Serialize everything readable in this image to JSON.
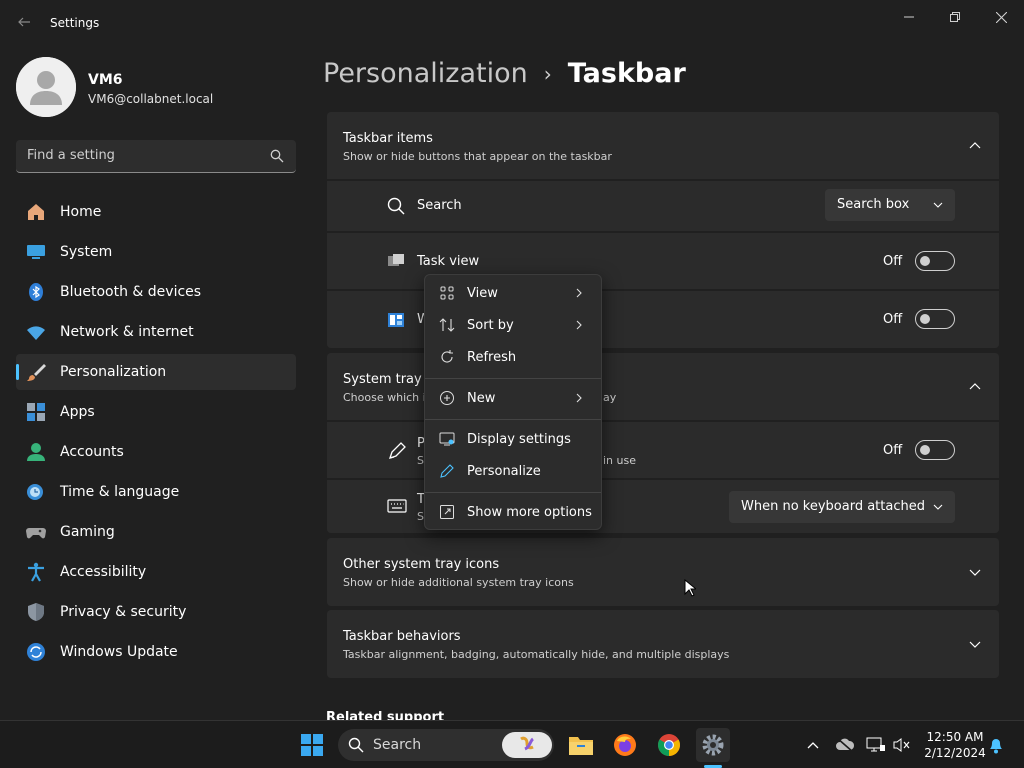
{
  "app": {
    "title": "Settings"
  },
  "user": {
    "name": "VM6",
    "email": "VM6@collabnet.local"
  },
  "search": {
    "placeholder": "Find a setting"
  },
  "nav": [
    {
      "label": "Home",
      "icon": "home-icon"
    },
    {
      "label": "System",
      "icon": "system-icon"
    },
    {
      "label": "Bluetooth & devices",
      "icon": "bluetooth-icon"
    },
    {
      "label": "Network & internet",
      "icon": "wifi-icon"
    },
    {
      "label": "Personalization",
      "icon": "brush-icon",
      "active": true
    },
    {
      "label": "Apps",
      "icon": "apps-icon"
    },
    {
      "label": "Accounts",
      "icon": "accounts-icon"
    },
    {
      "label": "Time & language",
      "icon": "clock-icon"
    },
    {
      "label": "Gaming",
      "icon": "gamepad-icon"
    },
    {
      "label": "Accessibility",
      "icon": "accessibility-icon"
    },
    {
      "label": "Privacy & security",
      "icon": "shield-icon"
    },
    {
      "label": "Windows Update",
      "icon": "update-icon"
    }
  ],
  "breadcrumb": {
    "parent": "Personalization",
    "separator": "›",
    "current": "Taskbar"
  },
  "taskbar_items": {
    "title": "Taskbar items",
    "subtitle": "Show or hide buttons that appear on the taskbar",
    "search": {
      "label": "Search",
      "value": "Search box"
    },
    "task_view": {
      "label": "Task view",
      "state": "Off"
    },
    "widgets": {
      "label": "W",
      "state": "Off"
    }
  },
  "system_tray": {
    "title_part": "System tray ic",
    "subtitle_part": "Choose which i",
    "subtitle_tail": "ay",
    "pen": {
      "label": "P",
      "sub": "S",
      "sub_tail": "in use",
      "state": "Off"
    },
    "keyboard": {
      "label": "T",
      "sub": "S",
      "value": "When no keyboard attached"
    }
  },
  "other_tray": {
    "title": "Other system tray icons",
    "subtitle": "Show or hide additional system tray icons"
  },
  "behaviors": {
    "title": "Taskbar behaviors",
    "subtitle": "Taskbar alignment, badging, automatically hide, and multiple displays"
  },
  "related": {
    "label": "Related support"
  },
  "context_menu": {
    "view": "View",
    "sort_by": "Sort by",
    "refresh": "Refresh",
    "new": "New",
    "display_settings": "Display settings",
    "personalize": "Personalize",
    "show_more": "Show more options"
  },
  "win_taskbar": {
    "search_label": "Search",
    "time": "12:50 AM",
    "date": "2/12/2024"
  },
  "colors": {
    "accent": "#4cc2ff",
    "background": "#202020",
    "card": "#2b2b2b"
  }
}
